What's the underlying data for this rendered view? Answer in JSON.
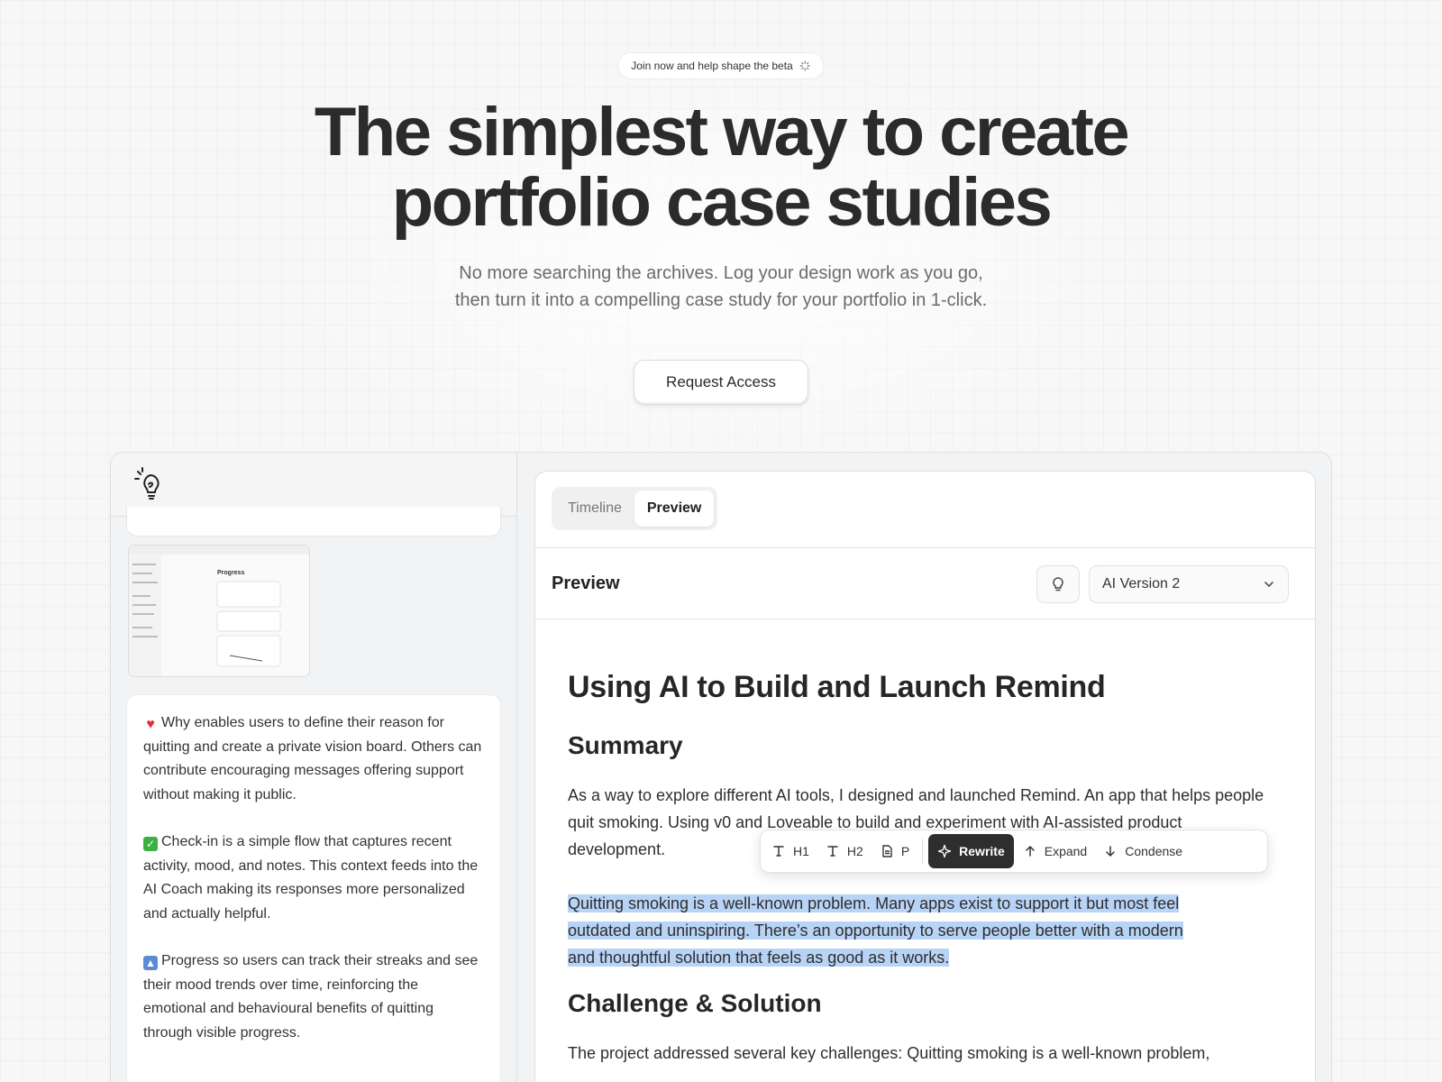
{
  "hero": {
    "beta_label": "Join now and help shape the beta",
    "title_line1": "The simplest way to create",
    "title_line2": "portfolio case studies",
    "subtitle_line1": "No more searching the archives. Log your design work as you go,",
    "subtitle_line2": "then turn it into a compelling case study for your portfolio in 1-click.",
    "cta_label": "Request Access"
  },
  "left_pane": {
    "thumbnail": {
      "title": "Progress"
    },
    "notes": [
      {
        "icon": "heart-icon",
        "text": "Why enables users to define their reason for quitting and create a private vision board. Others can contribute encouraging messages offering support without making it public."
      },
      {
        "icon": "check-icon",
        "text": "Check-in is a simple flow that captures recent activity, mood, and notes. This context feeds into the AI Coach making its responses more personalized and actually helpful."
      },
      {
        "icon": "up-arrow-icon",
        "text": "Progress so users can track their streaks and see their mood trends over time, reinforcing the emotional and behavioural benefits of quitting through visible progress."
      }
    ]
  },
  "right_pane": {
    "tabs": [
      {
        "label": "Timeline",
        "active": false
      },
      {
        "label": "Preview",
        "active": true
      }
    ],
    "preview_title": "Preview",
    "version_select": {
      "value": "AI Version 2"
    },
    "doc": {
      "title": "Using AI to Build and Launch Remind",
      "summary_heading": "Summary",
      "summary_text": "As a way to explore different AI tools, I designed and launched Remind. An app that helps people quit smoking. Using v0 and Loveable to build and experiment with AI-assisted product development.",
      "selected_text_line1": "Quitting smoking is a well-known problem. Many apps exist to support it but most feel",
      "selected_text_line2": "outdated and uninspiring. There’s an opportunity to serve people better with a modern",
      "selected_text_line3": "and thoughtful solution that feels as good as it works.",
      "challenge_heading": "Challenge & Solution",
      "challenge_text": "The project addressed several key challenges: Quitting smoking is a well-known problem,"
    },
    "toolbar": {
      "h1_label": "H1",
      "h2_label": "H2",
      "p_label": "P",
      "rewrite_label": "Rewrite",
      "expand_label": "Expand",
      "condense_label": "Condense"
    }
  },
  "colors": {
    "selection": "#b7d3f5",
    "primary_button": "#2e2e2e",
    "heart": "#e0313b",
    "check": "#3cb043",
    "arrow_box": "#5b8bd6"
  }
}
